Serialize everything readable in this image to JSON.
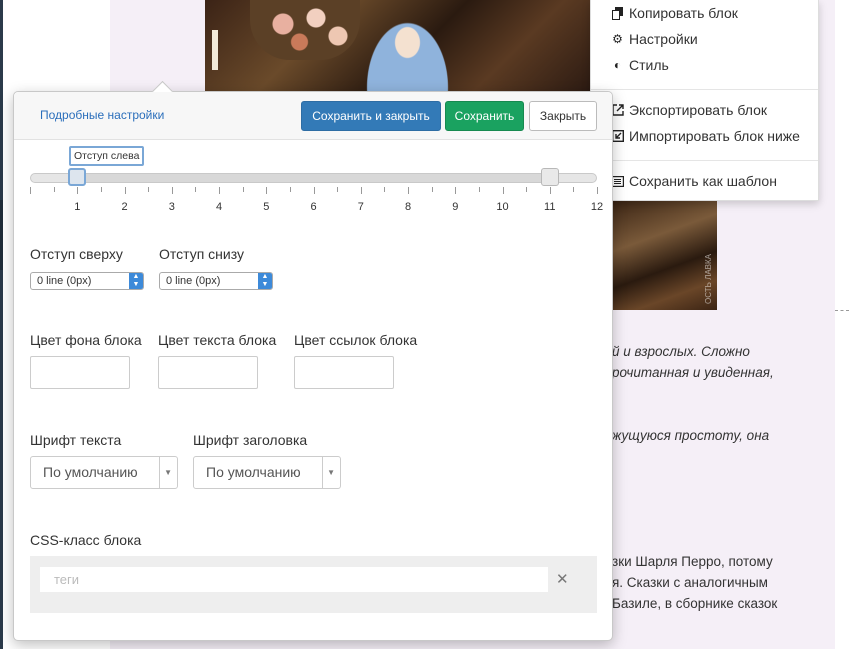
{
  "menu": {
    "items_top": [
      {
        "icon": "copy-icon",
        "label": "Копировать блок"
      },
      {
        "icon": "gear-icon",
        "label": "Настройки"
      },
      {
        "icon": "contrast-icon",
        "label": "Стиль"
      }
    ],
    "items_middle": [
      {
        "icon": "external-link-icon",
        "label": "Экспортировать блок"
      },
      {
        "icon": "import-icon",
        "label": "Импортировать блок ниже"
      }
    ],
    "items_bottom": [
      {
        "icon": "list-icon",
        "label": "Сохранить как шаблон"
      }
    ]
  },
  "background_text": {
    "lines": [
      {
        "text": "й и взрослых. Сложно",
        "italic": true
      },
      {
        "text": "рочитанная и увиденная,",
        "italic": true
      },
      {
        "text": "жущуюся простоту, она",
        "italic": true
      },
      {
        "text": "зки Шарля Перро, потому",
        "italic": false
      },
      {
        "text": "я. Сказки с аналогичным",
        "italic": false
      },
      {
        "text": "Базиле, в сборнике сказок",
        "italic": false
      }
    ],
    "photo_watermark": "ОСТЬ ЛАВКА"
  },
  "popover": {
    "advanced_link": "Подробные настройки",
    "buttons": {
      "save_close": "Сохранить и закрыть",
      "save": "Сохранить",
      "close": "Закрыть"
    },
    "slider": {
      "tooltip": "Отступ слева",
      "min": 0,
      "max": 12,
      "value_left": 1,
      "value_right": 11,
      "tick_labels": [
        "1",
        "2",
        "3",
        "4",
        "5",
        "6",
        "7",
        "8",
        "9",
        "10",
        "11",
        "12"
      ]
    },
    "padding_top": {
      "label": "Отступ сверху",
      "value": "0 line (0px)"
    },
    "padding_bottom": {
      "label": "Отступ снизу",
      "value": "0 line (0px)"
    },
    "colors": {
      "bg_label": "Цвет фона блока",
      "text_label": "Цвет текста блока",
      "link_label": "Цвет ссылок блока"
    },
    "fonts": {
      "text_label": "Шрифт текста",
      "text_value": "По умолчанию",
      "heading_label": "Шрифт заголовка",
      "heading_value": "По умолчанию"
    },
    "css_class": {
      "label": "CSS-класс блока",
      "placeholder": "теги",
      "clear_glyph": "✕"
    }
  }
}
